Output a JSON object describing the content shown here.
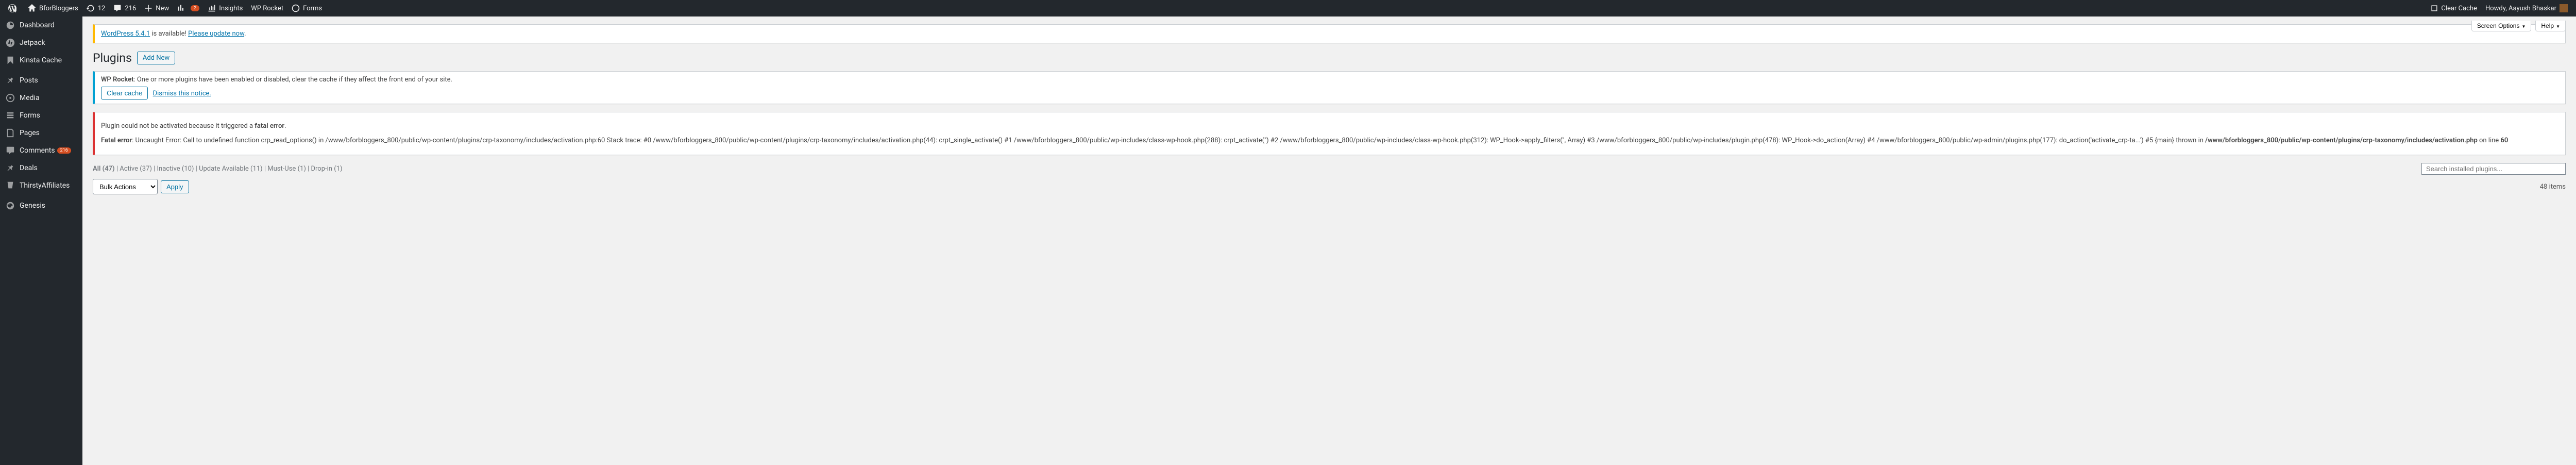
{
  "adminbar": {
    "site_name": "BforBloggers",
    "updates_count": "12",
    "comments_count": "216",
    "new_label": "New",
    "stats_badge": "2",
    "insights_label": "Insights",
    "wprocket_label": "WP Rocket",
    "forms_label": "Forms",
    "clear_cache_label": "Clear Cache",
    "howdy_text": "Howdy, Aayush Bhaskar"
  },
  "screen_options": {
    "screen_label": "Screen Options",
    "help_label": "Help"
  },
  "sidebar": {
    "items": [
      {
        "label": "Dashboard"
      },
      {
        "label": "Jetpack"
      },
      {
        "label": "Kinsta Cache"
      },
      {
        "label": "Posts"
      },
      {
        "label": "Media"
      },
      {
        "label": "Forms"
      },
      {
        "label": "Pages"
      },
      {
        "label": "Comments",
        "badge": "216"
      },
      {
        "label": "Deals"
      },
      {
        "label": "ThirstyAffiliates"
      },
      {
        "label": "Genesis"
      }
    ]
  },
  "update_notice": {
    "link_text": "WordPress 5.4.1",
    "after_text": " is available! ",
    "update_link": "Please update now",
    "dot": "."
  },
  "page_title": "Plugins",
  "add_new_label": "Add New",
  "wprocket_notice": {
    "prefix": "WP Rocket",
    "text": ": One or more plugins have been enabled or disabled, clear the cache if they affect the front end of your site.",
    "clear_btn": "Clear cache",
    "dismiss": "Dismiss this notice."
  },
  "fatal_error": {
    "intro_pre": "Plugin could not be activated because it triggered a ",
    "intro_bold": "fatal error",
    "intro_dot": ".",
    "fatal_label": "Fatal error",
    "body": ": Uncaught Error: Call to undefined function crp_read_options() in /www/bforbloggers_800/public/wp-content/plugins/crp-taxonomy/includes/activation.php:60 Stack trace: #0 /www/bforbloggers_800/public/wp-content/plugins/crp-taxonomy/includes/activation.php(44): crpt_single_activate() #1 /www/bforbloggers_800/public/wp-includes/class-wp-hook.php(288): crpt_activate('') #2 /www/bforbloggers_800/public/wp-includes/class-wp-hook.php(312): WP_Hook->apply_filters('', Array) #3 /www/bforbloggers_800/public/wp-includes/plugin.php(478): WP_Hook->do_action(Array) #4 /www/bforbloggers_800/public/wp-admin/plugins.php(177): do_action('activate_crp-ta...') #5 {main} thrown in ",
    "path": "/www/bforbloggers_800/public/wp-content/plugins/crp-taxonomy/includes/activation.php",
    "on_line": " on line ",
    "line_no": "60"
  },
  "filters": {
    "all_label": "All",
    "all_count": "(47)",
    "active_label": "Active",
    "active_count": "(37)",
    "inactive_label": "Inactive",
    "inactive_count": "(10)",
    "update_label": "Update Available",
    "update_count": "(11)",
    "mustuse_label": "Must-Use",
    "mustuse_count": "(1)",
    "dropin_label": "Drop-in",
    "dropin_count": "(1)",
    "sep": "  |  "
  },
  "search_placeholder": "Search installed plugins...",
  "bulk_action_label": "Bulk Actions",
  "apply_label": "Apply",
  "item_count": "48 items"
}
